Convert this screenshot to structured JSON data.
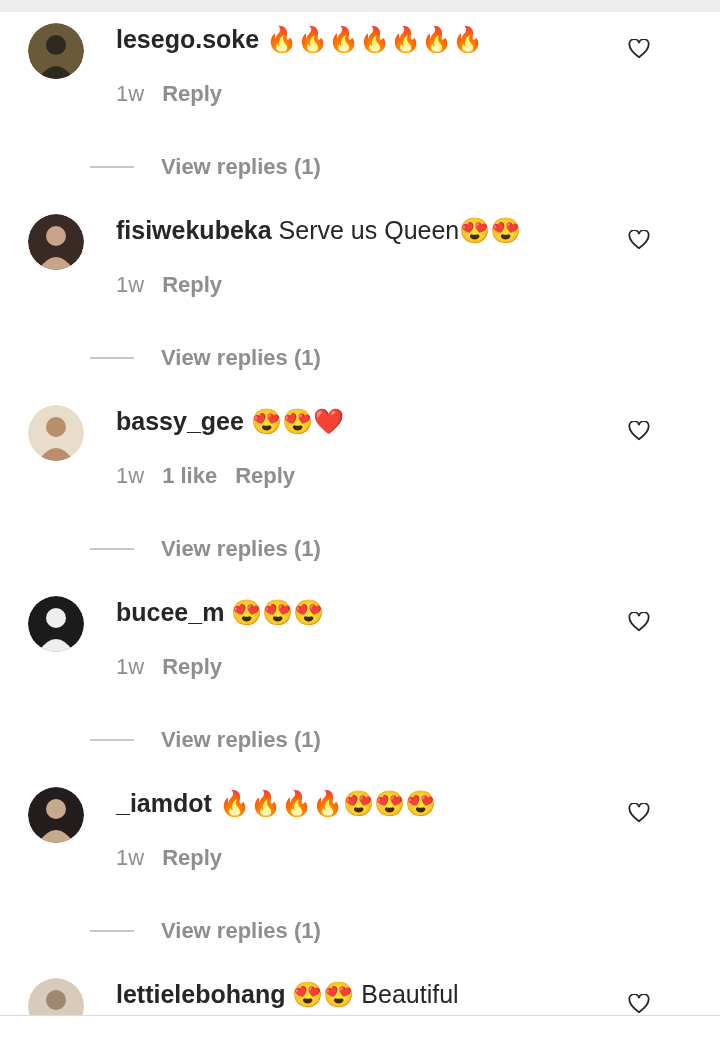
{
  "comments": [
    {
      "username": "lesego.soke",
      "text": "🔥🔥🔥🔥🔥🔥🔥",
      "time": "1w",
      "reply": "Reply",
      "view_replies": "View replies (1)",
      "liked": false
    },
    {
      "username": "fisiwekubeka",
      "text": "Serve us Queen😍😍",
      "time": "1w",
      "reply": "Reply",
      "view_replies": "View replies (1)",
      "liked": false
    },
    {
      "username": "bassy_gee",
      "text": "😍😍❤️",
      "time": "1w",
      "likes": "1 like",
      "reply": "Reply",
      "view_replies": "View replies (1)",
      "liked": false
    },
    {
      "username": "bucee_m",
      "text": "😍😍😍",
      "time": "1w",
      "reply": "Reply",
      "view_replies": "View replies (1)",
      "liked": false
    },
    {
      "username": "_iamdot",
      "text": "🔥🔥🔥🔥😍😍😍",
      "time": "1w",
      "reply": "Reply",
      "view_replies": "View replies (1)",
      "liked": false
    },
    {
      "username": "lettielebohang",
      "text": "😍😍 Beautiful",
      "liked": false
    }
  ]
}
